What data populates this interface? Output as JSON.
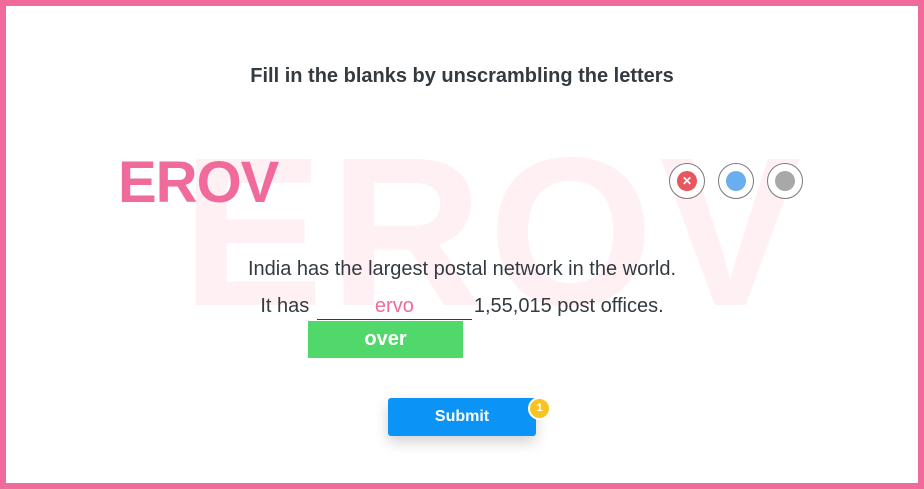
{
  "instruction": "Fill in the blanks by unscrambling the letters",
  "word": {
    "scrambled": "EROV",
    "watermark": "EROV"
  },
  "controls": {
    "close_glyph": "✕",
    "colors": {
      "close": "#e8565e",
      "blue": "#6aaeef",
      "grey": "#a8a8a8"
    }
  },
  "sentence": {
    "line1": "India has the largest postal network in the world.",
    "line2_before": "It has",
    "blank_value": "ervo",
    "line2_after": "1,55,015 post offices."
  },
  "answer": "over",
  "submit": {
    "label": "Submit",
    "badge": "1"
  },
  "colors": {
    "accent": "#f06a9c",
    "correct": "#50d86a",
    "primary": "#0b93f5",
    "badge": "#f7c422"
  }
}
